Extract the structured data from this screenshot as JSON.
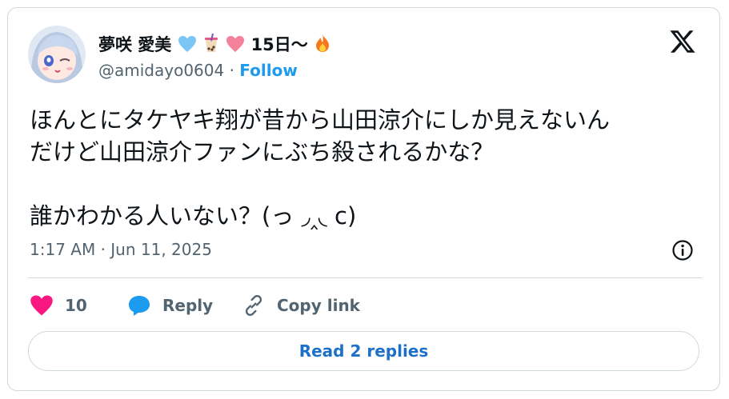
{
  "author": {
    "display_name": "夢咲 愛美",
    "name_suffix": "15日〜",
    "handle": "@amidayo0604",
    "separator": "·",
    "follow_label": "Follow"
  },
  "tweet": {
    "line1": "ほんとにタケヤキ翔が昔から山田涼介にしか見えないん",
    "line2": "だけど山田涼介ファンにぶち殺されるかな？",
    "line3": "誰かわかる人いない？(っ ◞‸◟ c)",
    "timestamp": "1:17 AM · Jun 11, 2025"
  },
  "actions": {
    "like_count": "10",
    "reply_label": "Reply",
    "copy_link_label": "Copy link"
  },
  "read_replies_label": "Read 2 replies",
  "colors": {
    "accent": "#1d9bf0",
    "like": "#f91880",
    "text_secondary": "#536471",
    "border": "#cfd9de"
  }
}
